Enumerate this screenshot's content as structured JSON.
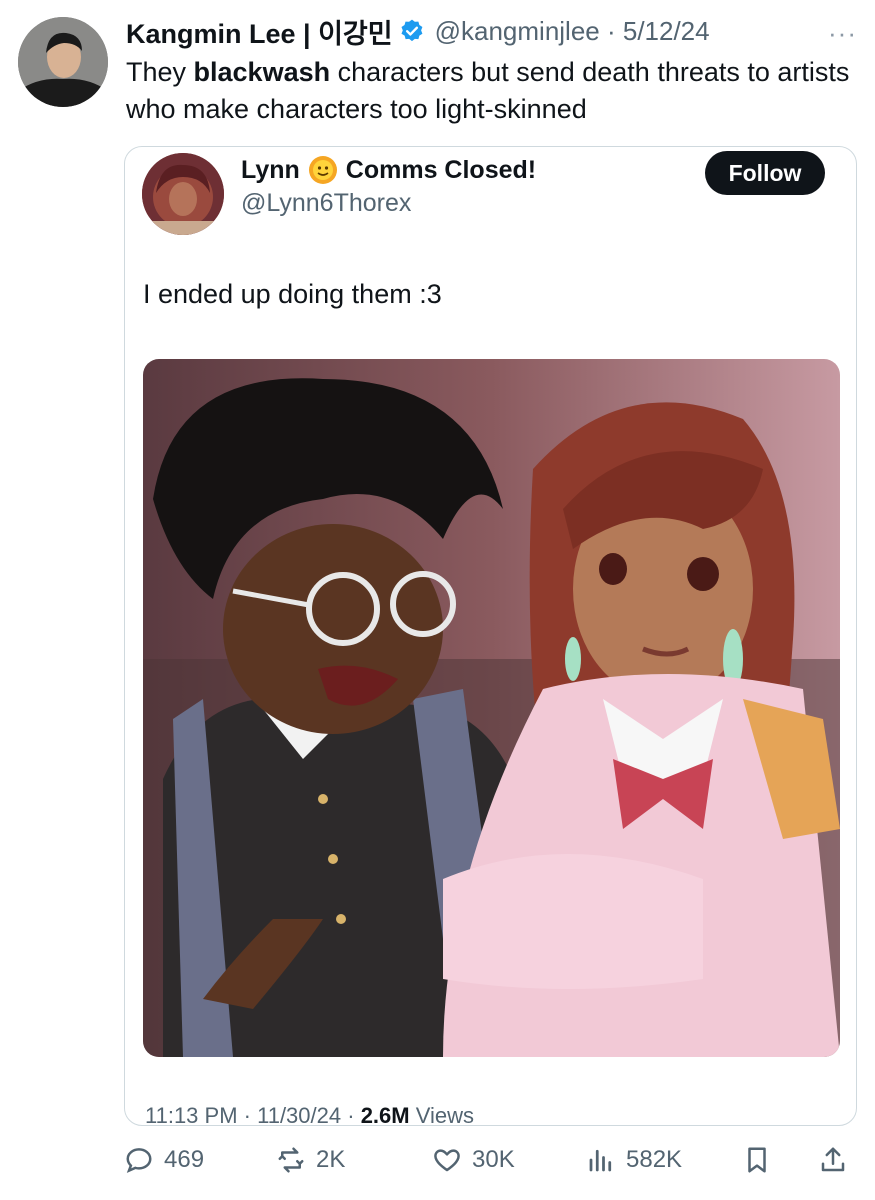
{
  "tweet": {
    "author_name": "Kangmin Lee | 이강민",
    "handle": "@kangminjlee",
    "date": "5/12/24",
    "text_before": "They ",
    "text_bold": "blackwash",
    "text_after": " characters but send death threats to artists who make characters too light-skinned"
  },
  "quoted": {
    "name_part1": "Lynn",
    "name_part2": "Comms Closed!",
    "handle": "@Lynn6Thorex",
    "follow_label": "Follow",
    "text": "I ended up doing them :3",
    "time": "11:13 PM",
    "date": "11/30/24",
    "views_count": "2.6M",
    "views_label": "Views"
  },
  "actions": {
    "replies": "469",
    "reposts": "2K",
    "likes": "30K",
    "views": "582K"
  },
  "colors": {
    "text": "#0f1419",
    "secondary": "#536471",
    "verified": "#1d9bf0",
    "border": "#cfd9de"
  }
}
